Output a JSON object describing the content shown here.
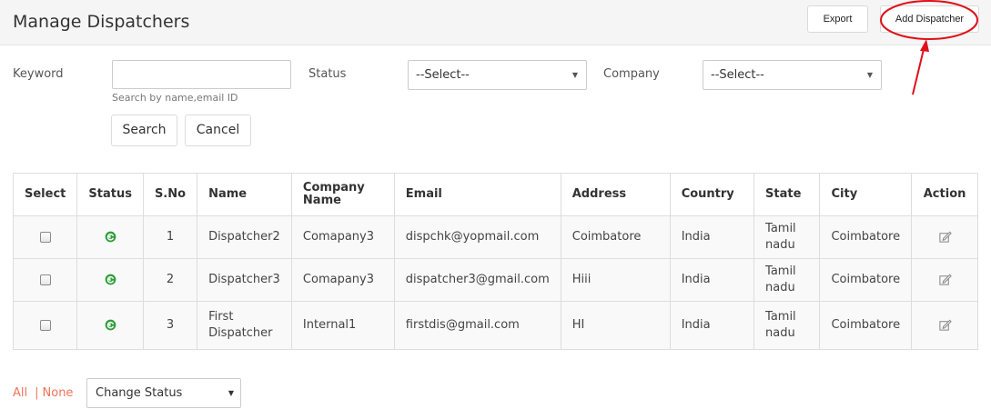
{
  "header": {
    "title": "Manage Dispatchers",
    "export_label": "Export",
    "add_label": "Add Dispatcher"
  },
  "filters": {
    "keyword_label": "Keyword",
    "keyword_value": "",
    "keyword_hint": "Search by name,email ID",
    "status_label": "Status",
    "status_selected": "--Select--",
    "company_label": "Company",
    "company_selected": "--Select--",
    "search_label": "Search",
    "cancel_label": "Cancel"
  },
  "table": {
    "columns": [
      "Select",
      "Status",
      "S.No",
      "Name",
      "Company Name",
      "Email",
      "Address",
      "Country",
      "State",
      "City",
      "Action"
    ],
    "rows": [
      {
        "sno": "1",
        "name": "Dispatcher2",
        "company": "Comapany3",
        "email": "dispchk@yopmail.com",
        "address": "Coimbatore",
        "country": "India",
        "state": "Tamil nadu",
        "city": "Coimbatore"
      },
      {
        "sno": "2",
        "name": "Dispatcher3",
        "company": "Comapany3",
        "email": "dispatcher3@gmail.com",
        "address": "Hiii",
        "country": "India",
        "state": "Tamil nadu",
        "city": "Coimbatore"
      },
      {
        "sno": "3",
        "name": "First Dispatcher",
        "company": "Internal1",
        "email": "firstdis@gmail.com",
        "address": "HI",
        "country": "India",
        "state": "Tamil nadu",
        "city": "Coimbatore"
      }
    ]
  },
  "bulk": {
    "all_label": "All",
    "sep": "|",
    "none_label": "None",
    "change_status_label": "Change Status"
  },
  "icons": {
    "status": "status-active-icon",
    "edit": "edit-icon",
    "caret": "chevron-down-icon"
  },
  "colors": {
    "link": "#f0735a",
    "status_green": "#2e9e3a",
    "annotation": "#e0101a"
  }
}
